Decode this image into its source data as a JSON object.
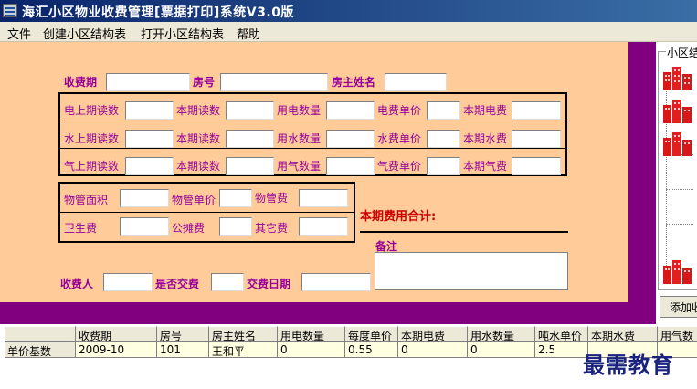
{
  "window": {
    "title": "海汇小区物业收费管理[票据打印]系统V3.0版"
  },
  "menu": {
    "items": [
      "文件",
      "创建小区结构表",
      "打开小区结构表",
      "帮助"
    ]
  },
  "form": {
    "period_label": "收费期",
    "room_label": "房号",
    "owner_label": "房主姓名",
    "electric": {
      "last_label": "电上期读数",
      "current_label": "本期读数",
      "usage_label": "用电数量",
      "price_label": "电费单价",
      "fee_label": "本期电费"
    },
    "water": {
      "last_label": "水上期读数",
      "current_label": "本期读数",
      "usage_label": "用水数量",
      "price_label": "水费单价",
      "fee_label": "本期水费"
    },
    "gas": {
      "last_label": "气上期读数",
      "current_label": "本期读数",
      "usage_label": "用气数量",
      "price_label": "气费单价",
      "fee_label": "本期气费"
    },
    "property": {
      "area_label": "物管面积",
      "price_label": "物管单价",
      "fee_label": "物管费",
      "sanitation_label": "卫生费",
      "shared_label": "公摊费",
      "other_label": "其它费"
    },
    "total_label": "本期费用合计:",
    "notes_label": "备注",
    "collector_label": "收费人",
    "paid_label": "是否交费",
    "pay_date_label": "交费日期"
  },
  "side_panel": {
    "legend": "小区结构",
    "add_button": "添加收"
  },
  "grid": {
    "columns": [
      "",
      "收费期",
      "房号",
      "房主姓名",
      "用电数量",
      "每度单价",
      "本期电费",
      "用水数量",
      "吨水单价",
      "本期水费",
      "用气数"
    ],
    "rows": [
      [
        "单价基数",
        "2009-10",
        "101",
        "王和平",
        "0",
        "0.55",
        "0",
        "0",
        "2.5",
        "",
        ""
      ]
    ]
  },
  "watermark": "最需教育"
}
